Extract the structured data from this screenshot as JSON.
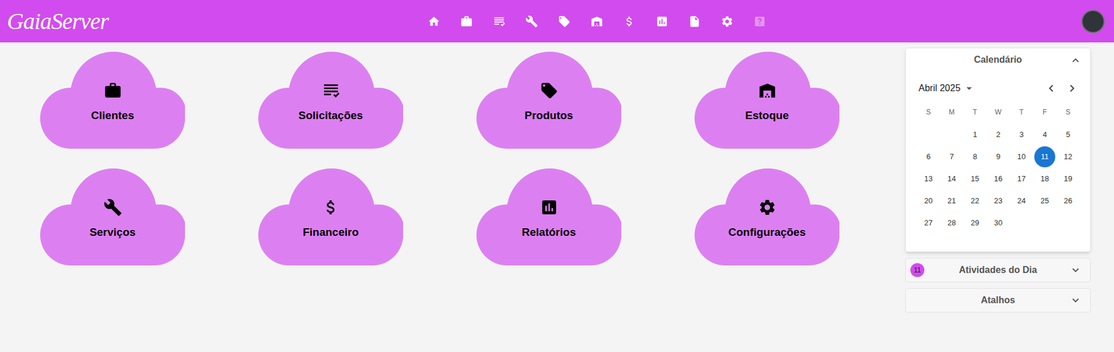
{
  "logo": "GaiaServer",
  "nav": [
    {
      "disabled": false
    },
    {
      "disabled": false
    },
    {
      "disabled": false
    },
    {
      "disabled": false
    },
    {
      "disabled": false
    },
    {
      "disabled": false
    },
    {
      "disabled": false
    },
    {
      "disabled": false
    },
    {
      "disabled": false
    },
    {
      "disabled": false
    },
    {
      "disabled": true
    }
  ],
  "tiles": [
    {
      "label": "Clientes"
    },
    {
      "label": "Solicitações"
    },
    {
      "label": "Produtos"
    },
    {
      "label": "Estoque"
    },
    {
      "label": "Serviços"
    },
    {
      "label": "Financeiro"
    },
    {
      "label": "Relatórios"
    },
    {
      "label": "Configurações"
    }
  ],
  "calendar": {
    "title": "Calendário",
    "expanded": true,
    "month": "Abril 2025",
    "weekdays": [
      "S",
      "M",
      "T",
      "W",
      "T",
      "F",
      "S"
    ],
    "weeks": [
      [
        null,
        null,
        {
          "label": "1",
          "selected": false
        },
        {
          "label": "2",
          "selected": false
        },
        {
          "label": "3",
          "selected": false
        },
        {
          "label": "4",
          "selected": false
        },
        {
          "label": "5",
          "selected": false
        }
      ],
      [
        {
          "label": "6",
          "selected": false
        },
        {
          "label": "7",
          "selected": false
        },
        {
          "label": "8",
          "selected": false
        },
        {
          "label": "9",
          "selected": false
        },
        {
          "label": "10",
          "selected": false
        },
        {
          "label": "11",
          "selected": true
        },
        {
          "label": "12",
          "selected": false
        }
      ],
      [
        {
          "label": "13",
          "selected": false
        },
        {
          "label": "14",
          "selected": false
        },
        {
          "label": "15",
          "selected": false
        },
        {
          "label": "16",
          "selected": false
        },
        {
          "label": "17",
          "selected": false
        },
        {
          "label": "18",
          "selected": false
        },
        {
          "label": "19",
          "selected": false
        }
      ],
      [
        {
          "label": "20",
          "selected": false
        },
        {
          "label": "21",
          "selected": false
        },
        {
          "label": "22",
          "selected": false
        },
        {
          "label": "23",
          "selected": false
        },
        {
          "label": "24",
          "selected": false
        },
        {
          "label": "25",
          "selected": false
        },
        {
          "label": "26",
          "selected": false
        }
      ],
      [
        {
          "label": "27",
          "selected": false
        },
        {
          "label": "28",
          "selected": false
        },
        {
          "label": "29",
          "selected": false
        },
        {
          "label": "30",
          "selected": false
        }
      ]
    ]
  },
  "sections": [
    {
      "title": "Atividades do Dia",
      "expanded": false,
      "badge": "11"
    },
    {
      "title": "Atalhos",
      "expanded": false
    }
  ]
}
